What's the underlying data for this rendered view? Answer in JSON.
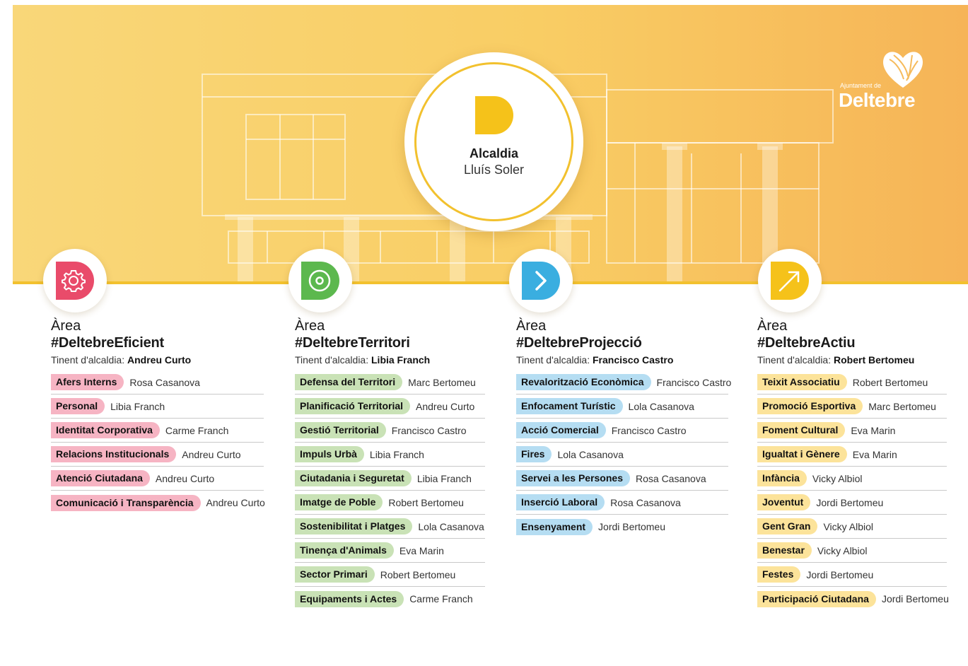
{
  "brand": {
    "small": "Ajuntament de",
    "name": "Deltebre",
    "accent": "#f2c12e",
    "icon": "deltebre-logo-mark"
  },
  "mayor": {
    "title": "Alcaldia",
    "name": "Lluís Soler",
    "icon": "letter-d-icon"
  },
  "areas": [
    {
      "word": "Àrea",
      "tag": "#DeltebreEficient",
      "lead_label": "Tinent d'alcaldia:",
      "lead_name": "Andreu Curto",
      "icon": "gear-icon",
      "color": "#e94b6a",
      "items": [
        {
          "label": "Afers Interns",
          "person": "Rosa Casanova"
        },
        {
          "label": "Personal",
          "person": "Libia Franch"
        },
        {
          "label": "Identitat Corporativa",
          "person": "Carme Franch"
        },
        {
          "label": "Relacions Institucionals",
          "person": "Andreu Curto"
        },
        {
          "label": "Atenció Ciutadana",
          "person": "Andreu Curto"
        },
        {
          "label": "Comunicació i Transparència",
          "person": "Andreu Curto"
        }
      ]
    },
    {
      "word": "Àrea",
      "tag": "#DeltebreTerritori",
      "lead_label": "Tinent d'alcaldia:",
      "lead_name": "Libia Franch",
      "icon": "target-icon",
      "color": "#5cb84e",
      "items": [
        {
          "label": "Defensa del Territori",
          "person": "Marc Bertomeu"
        },
        {
          "label": "Planificació Territorial",
          "person": "Andreu Curto"
        },
        {
          "label": "Gestió Territorial",
          "person": "Francisco Castro"
        },
        {
          "label": "Impuls Urbà",
          "person": "Libia Franch"
        },
        {
          "label": "Ciutadania i Seguretat",
          "person": "Libia Franch"
        },
        {
          "label": "Imatge de Poble",
          "person": "Robert Bertomeu"
        },
        {
          "label": "Sostenibilitat i Platges",
          "person": "Lola Casanova"
        },
        {
          "label": "Tinença d'Animals",
          "person": "Eva Marin"
        },
        {
          "label": "Sector Primari",
          "person": "Robert Bertomeu"
        },
        {
          "label": "Equipaments i Actes",
          "person": "Carme Franch"
        }
      ]
    },
    {
      "word": "Àrea",
      "tag": "#DeltebreProjecció",
      "lead_label": "Tinent d'alcaldia:",
      "lead_name": "Francisco Castro",
      "icon": "chevron-right-icon",
      "color": "#3aaee0",
      "items": [
        {
          "label": "Revalorització Econòmica",
          "person": "Francisco Castro"
        },
        {
          "label": "Enfocament Turístic",
          "person": "Lola Casanova"
        },
        {
          "label": "Acció Comercial",
          "person": "Francisco Castro"
        },
        {
          "label": "Fires",
          "person": "Lola Casanova"
        },
        {
          "label": "Servei a les Persones",
          "person": "Rosa Casanova"
        },
        {
          "label": "Inserció Laboral",
          "person": "Rosa Casanova"
        },
        {
          "label": "Ensenyament",
          "person": "Jordi Bertomeu"
        }
      ]
    },
    {
      "word": "Àrea",
      "tag": "#DeltebreActiu",
      "lead_label": "Tinent d'alcaldia:",
      "lead_name": "Robert Bertomeu",
      "icon": "arrow-up-right-icon",
      "color": "#f5c21a",
      "items": [
        {
          "label": "Teixit Associatiu",
          "person": "Robert Bertomeu"
        },
        {
          "label": "Promoció Esportiva",
          "person": "Marc Bertomeu"
        },
        {
          "label": "Foment Cultural",
          "person": "Eva Marin"
        },
        {
          "label": "Igualtat i Gènere",
          "person": "Eva Marin"
        },
        {
          "label": "Infància",
          "person": "Vicky Albiol"
        },
        {
          "label": "Joventut",
          "person": "Jordi Bertomeu"
        },
        {
          "label": "Gent Gran",
          "person": "Vicky Albiol"
        },
        {
          "label": "Benestar",
          "person": "Vicky Albiol"
        },
        {
          "label": "Festes",
          "person": "Jordi Bertomeu"
        },
        {
          "label": "Participació Ciutadana",
          "person": "Jordi Bertomeu"
        }
      ]
    }
  ]
}
